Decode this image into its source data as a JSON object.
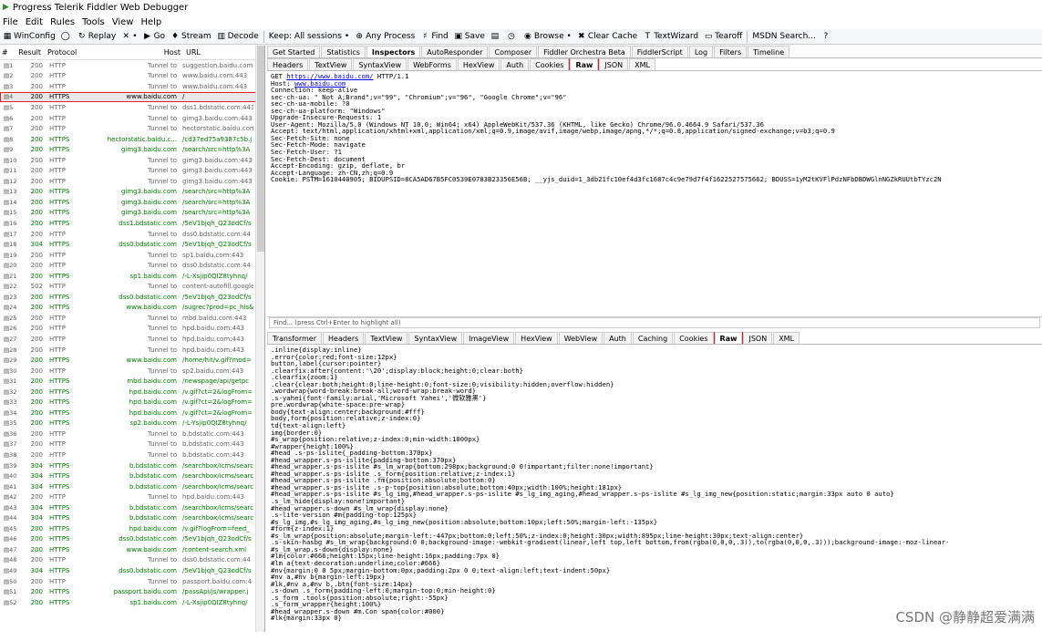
{
  "app": {
    "title": "Progress Telerik Fiddler Web Debugger"
  },
  "menu": [
    "File",
    "Edit",
    "Rules",
    "Tools",
    "View",
    "Help"
  ],
  "toolbar": [
    {
      "name": "winconfig-button",
      "icon": "winconfig-icon",
      "glyph": "▦",
      "label": "WinConfig"
    },
    {
      "name": "comment-button",
      "icon": "comment-icon",
      "glyph": "◯",
      "label": ""
    },
    {
      "name": "replay-button",
      "icon": "replay-icon",
      "glyph": "↻",
      "label": "Replay"
    },
    {
      "name": "remove-button",
      "icon": "remove-icon",
      "glyph": "✕",
      "label": "•"
    },
    {
      "name": "go-button",
      "icon": "go-icon",
      "glyph": "▶",
      "label": "Go"
    },
    {
      "name": "stream-button",
      "icon": "stream-icon",
      "glyph": "♦",
      "label": "Stream"
    },
    {
      "name": "decode-button",
      "icon": "decode-icon",
      "glyph": "▥",
      "label": "Decode"
    },
    {
      "name": "keep-sessions-dropdown",
      "icon": "",
      "glyph": "",
      "label": "Keep: All sessions •"
    },
    {
      "name": "any-process-button",
      "icon": "crosshair-icon",
      "glyph": "⊕",
      "label": "Any Process"
    },
    {
      "name": "find-button",
      "icon": "binoculars-icon",
      "glyph": "♯",
      "label": "Find"
    },
    {
      "name": "save-button",
      "icon": "save-icon",
      "glyph": "▣",
      "label": "Save"
    },
    {
      "name": "screenshot-button",
      "icon": "screenshot-icon",
      "glyph": "▤",
      "label": ""
    },
    {
      "name": "timer-button",
      "icon": "timer-icon",
      "glyph": "◷",
      "label": ""
    },
    {
      "name": "browse-button",
      "icon": "browser-icon",
      "glyph": "◉",
      "label": "Browse •"
    },
    {
      "name": "clear-cache-button",
      "icon": "clear-cache-icon",
      "glyph": "✖",
      "label": "Clear Cache"
    },
    {
      "name": "textwizard-button",
      "icon": "textwizard-icon",
      "glyph": "T",
      "label": "TextWizard"
    },
    {
      "name": "tearoff-button",
      "icon": "tearoff-icon",
      "glyph": "▭",
      "label": "Tearoff"
    },
    {
      "name": "msdn-search",
      "icon": "",
      "glyph": "",
      "label": "MSDN Search..."
    },
    {
      "name": "help-button",
      "icon": "help-icon",
      "glyph": "?",
      "label": ""
    }
  ],
  "sessions": {
    "headers": [
      "#",
      "Result",
      "Protocol",
      "Host",
      "URL"
    ],
    "rows": [
      [
        "1",
        "200",
        "HTTP",
        "Tunnel to",
        "suggestion.baidu.com"
      ],
      [
        "2",
        "200",
        "HTTP",
        "Tunnel to",
        "www.baidu.com:443"
      ],
      [
        "3",
        "200",
        "HTTP",
        "Tunnel to",
        "www.baidu.com:443"
      ],
      [
        "4",
        "200",
        "HTTPS",
        "www.baidu.com",
        "/"
      ],
      [
        "5",
        "200",
        "HTTP",
        "Tunnel to",
        "dss1.bdstatic.com:443"
      ],
      [
        "6",
        "200",
        "HTTP",
        "Tunnel to",
        "gimg3.baidu.com:443"
      ],
      [
        "7",
        "200",
        "HTTP",
        "Tunnel to",
        "hectorstatic.baidu.com"
      ],
      [
        "8",
        "200",
        "HTTPS",
        "hectorstatic.baidu.c...",
        "/cd37ed75a9387c5b.j"
      ],
      [
        "9",
        "200",
        "HTTPS",
        "gimg3.baidu.com",
        "/search/src=http%3A"
      ],
      [
        "10",
        "200",
        "HTTP",
        "Tunnel to",
        "gimg3.baidu.com:443"
      ],
      [
        "11",
        "200",
        "HTTP",
        "Tunnel to",
        "gimg3.baidu.com:443"
      ],
      [
        "12",
        "200",
        "HTTP",
        "Tunnel to",
        "gimg3.baidu.com:443"
      ],
      [
        "13",
        "200",
        "HTTPS",
        "gimg3.baidu.com",
        "/search/src=http%3A"
      ],
      [
        "14",
        "200",
        "HTTPS",
        "gimg3.baidu.com",
        "/search/src=http%3A"
      ],
      [
        "15",
        "200",
        "HTTPS",
        "gimg3.baidu.com",
        "/search/src=http%3A"
      ],
      [
        "16",
        "200",
        "HTTPS",
        "dss1.bdstatic.com",
        "/5eV1bjqh_Q23odCf/s"
      ],
      [
        "17",
        "200",
        "HTTP",
        "Tunnel to",
        "dss0.bdstatic.com:44"
      ],
      [
        "18",
        "304",
        "HTTPS",
        "dss0.bdstatic.com",
        "/5eV1bjqh_Q23odCf/s"
      ],
      [
        "19",
        "200",
        "HTTP",
        "Tunnel to",
        "sp1.baidu.com:443"
      ],
      [
        "20",
        "200",
        "HTTP",
        "Tunnel to",
        "dss0.bdstatic.com:44"
      ],
      [
        "21",
        "200",
        "HTTPS",
        "sp1.baidu.com",
        "/-L-Xsjip0QIZ8tyhnq/"
      ],
      [
        "22",
        "502",
        "HTTP",
        "Tunnel to",
        "content-autofill.google"
      ],
      [
        "23",
        "200",
        "HTTPS",
        "dss0.bdstatic.com",
        "/5eV1bjqh_Q23odCf/s"
      ],
      [
        "24",
        "200",
        "HTTPS",
        "www.baidu.com",
        "/sugrec?prod=pc_his&"
      ],
      [
        "25",
        "200",
        "HTTP",
        "Tunnel to",
        "mbd.baidu.com:443"
      ],
      [
        "26",
        "200",
        "HTTP",
        "Tunnel to",
        "hpd.baidu.com:443"
      ],
      [
        "27",
        "200",
        "HTTP",
        "Tunnel to",
        "hpd.baidu.com:443"
      ],
      [
        "28",
        "200",
        "HTTP",
        "Tunnel to",
        "hpd.baidu.com:443"
      ],
      [
        "29",
        "200",
        "HTTPS",
        "www.baidu.com",
        "/home/hit/v.gif?mod="
      ],
      [
        "30",
        "200",
        "HTTP",
        "Tunnel to",
        "sp2.baidu.com:443"
      ],
      [
        "31",
        "200",
        "HTTPS",
        "mbd.baidu.com",
        "/newspage/api/getpc"
      ],
      [
        "32",
        "200",
        "HTTPS",
        "hpd.baidu.com",
        "/v.gif?ct=2&logFrom="
      ],
      [
        "33",
        "200",
        "HTTPS",
        "hpd.baidu.com",
        "/v.gif?ct=2&logFrom="
      ],
      [
        "34",
        "200",
        "HTTPS",
        "hpd.baidu.com",
        "/v.gif?ct=2&logFrom="
      ],
      [
        "35",
        "200",
        "HTTPS",
        "sp2.baidu.com",
        "/-L-Ysjip0QIZ8tyhnq/"
      ],
      [
        "36",
        "200",
        "HTTP",
        "Tunnel to",
        "b.bdstatic.com:443"
      ],
      [
        "37",
        "200",
        "HTTP",
        "Tunnel to",
        "b.bdstatic.com:443"
      ],
      [
        "38",
        "200",
        "HTTP",
        "Tunnel to",
        "b.bdstatic.com:443"
      ],
      [
        "39",
        "304",
        "HTTPS",
        "b.bdstatic.com",
        "/searchbox/icms/searc"
      ],
      [
        "40",
        "304",
        "HTTPS",
        "b.bdstatic.com",
        "/searchbox/icms/searc"
      ],
      [
        "41",
        "304",
        "HTTPS",
        "b.bdstatic.com",
        "/searchbox/icms/searc"
      ],
      [
        "42",
        "200",
        "HTTP",
        "Tunnel to",
        "hpd.baidu.com:443"
      ],
      [
        "43",
        "304",
        "HTTPS",
        "b.bdstatic.com",
        "/searchbox/icms/searc"
      ],
      [
        "44",
        "304",
        "HTTPS",
        "b.bdstatic.com",
        "/searchbox/icms/searc"
      ],
      [
        "45",
        "200",
        "HTTPS",
        "hpd.baidu.com",
        "/v.gif?logFrom=feed_"
      ],
      [
        "46",
        "200",
        "HTTPS",
        "dss0.bdstatic.com",
        "/5eV1bjqh_Q23odCf/s"
      ],
      [
        "47",
        "200",
        "HTTPS",
        "www.baidu.com",
        "/content-search.xml"
      ],
      [
        "48",
        "200",
        "HTTP",
        "Tunnel to",
        "dss0.bdstatic.com:44"
      ],
      [
        "49",
        "304",
        "HTTPS",
        "dss0.bdstatic.com",
        "/5eV1bjqh_Q23odCf/s"
      ],
      [
        "50",
        "200",
        "HTTP",
        "Tunnel to",
        "passport.baidu.com:4"
      ],
      [
        "51",
        "200",
        "HTTPS",
        "passport.baidu.com",
        "/passApi/js/wrapper.j"
      ],
      [
        "52",
        "200",
        "HTTPS",
        "sp1.baidu.com",
        "/-L-Xsjip0QIZ8tyhnq/"
      ]
    ]
  },
  "top_tabs": [
    "Get Started",
    "Statistics",
    "Inspectors",
    "AutoResponder",
    "Composer",
    "Fiddler Orchestra Beta",
    "FiddlerScript",
    "Log",
    "Filters",
    "Timeline"
  ],
  "request_tabs": [
    "Headers",
    "TextView",
    "SyntaxView",
    "WebForms",
    "HexView",
    "Auth",
    "Cookies",
    "Raw",
    "JSON",
    "XML"
  ],
  "request_raw": {
    "line1_pre": "GET ",
    "line1_url": "https://www.baidu.com/",
    "line1_post": " HTTP/1.1",
    "host_pre": "Host: ",
    "host_url": "www.baidu.com",
    "rest": "Connection: keep-alive\nsec-ch-ua: \" Not A;Brand\";v=\"99\", \"Chromium\";v=\"96\", \"Google Chrome\";v=\"96\"\nsec-ch-ua-mobile: ?0\nsec-ch-ua-platform: \"Windows\"\nUpgrade-Insecure-Requests: 1\nUser-Agent: Mozilla/5.0 (Windows NT 10.0; Win64; x64) AppleWebKit/537.36 (KHTML, like Gecko) Chrome/96.0.4664.9 Safari/537.36\nAccept: text/html,application/xhtml+xml,application/xml;q=0.9,image/avif,image/webp,image/apng,*/*;q=0.8,application/signed-exchange;v=b3;q=0.9\nSec-Fetch-Site: none\nSec-Fetch-Mode: navigate\nSec-Fetch-User: ?1\nSec-Fetch-Dest: document\nAccept-Encoding: gzip, deflate, br\nAccept-Language: zh-CN,zh;q=0.9\nCookie: PSTM=1610440905; BIDUPSID=8CA5AD67B5FC0539E0783B23356E56B; __yjs_duid=1_3db21fc10ef4d3fc1687c4c9e79d7f4f1622527575662; BDUSS=1yM2tKVFlPdzNFbDBDWGlnNGZkRUUtbTYzc2N"
  },
  "find_placeholder": "Find... (press Ctrl+Enter to highlight all)",
  "response_tabs": [
    "Transformer",
    "Headers",
    "TextView",
    "SyntaxView",
    "ImageView",
    "HexView",
    "WebView",
    "Auth",
    "Caching",
    "Cookies",
    "Raw",
    "JSON",
    "XML"
  ],
  "response_raw": ".inline{display:inline}\n.error{color:red;font-size:12px}\nbutton,label{cursor:pointer}\n.clearfix:after{content:'\\20';display:block;height:0;clear:both}\n.clearfix{zoom:1}\n.clear{clear:both;height:0;line-height:0;font-size:0;visibility:hidden;overflow:hidden}\n.wordwrap{word-break:break-all;word-wrap:break-word}\n.s-yahei{font-family:arial,'Microsoft Yahei','微软雅黑'}\npre.wordwrap{white-space:pre-wrap}\nbody{text-align:center;background:#fff}\nbody,form{position:relative;z-index:0}\ntd{text-align:left}\nimg{border:0}\n#s_wrap{position:relative;z-index:0;min-width:1000px}\n#wrapper{height:100%}\n#head .s-ps-islite{_padding-bottom:370px}\n#head_wrapper.s-ps-islite{padding-bottom:370px}\n#head_wrapper.s-ps-islite #s_lm_wrap{bottom:298px;background:0 0!important;filter:none!important}\n#head_wrapper.s-ps-islite .s_form{position:relative;z-index:1}\n#head_wrapper.s-ps-islite .fm{position:absolute;bottom:0}\n#head_wrapper.s-ps-islite .s-p-top{position:absolute;bottom:40px;width:100%;height:181px}\n#head_wrapper.s-ps-islite #s_lg_img,#head_wrapper.s-ps-islite #s_lg_img_aging,#head_wrapper.s-ps-islite #s_lg_img_new{position:static;margin:33px auto 0 auto}\n.s_lm_hide{display:none!important}\n#head_wrapper.s-down #s_lm_wrap{display:none}\n.s-lite-version #m{padding-top:125px}\n#s_lg_img,#s_lg_img_aging,#s_lg_img_new{position:absolute;bottom:10px;left:50%;margin-left:-135px}\n#form{z-index:1}\n#s_lm_wrap{position:absolute;margin-left:-447px;bottom:0;left:50%;z-index:0;height:30px;width:895px;line-height:30px;text-align:center}\n.s-skin-hasbg #s_lm_wrap{background:0 0;background-image:-webkit-gradient(linear,left top,left bottom,from(rgba(0,0,0,.3)),to(rgba(0,0,0,.3)));background-image:-moz-linear-\n#s_lm_wrap.s-down{display:none}\n#lm{color:#666;height:15px;line-height:16px;padding:7px 0}\n#lm a{text-decoration:underline;color:#666}\n#nv{margin:0 0 5px;margin-bottom:0px;padding:2px 0 0;text-align:left;text-indent:50px}\n#nv a,#nv b{margin-left:19px}\n#lk,#nv a,#nv b,.btn{font-size:14px}\n.s-down .s_form{padding-left:0;margin-top:0;min-height:0}\n.s_form .tools{position:absolute;right:-55px}\n.s_form_wrapper{height:100%}\n#head_wrapper.s-down #m.Con span{color:#000}\n#lk{margin:33px 0}",
  "watermark": "CSDN @静静超爱满满"
}
